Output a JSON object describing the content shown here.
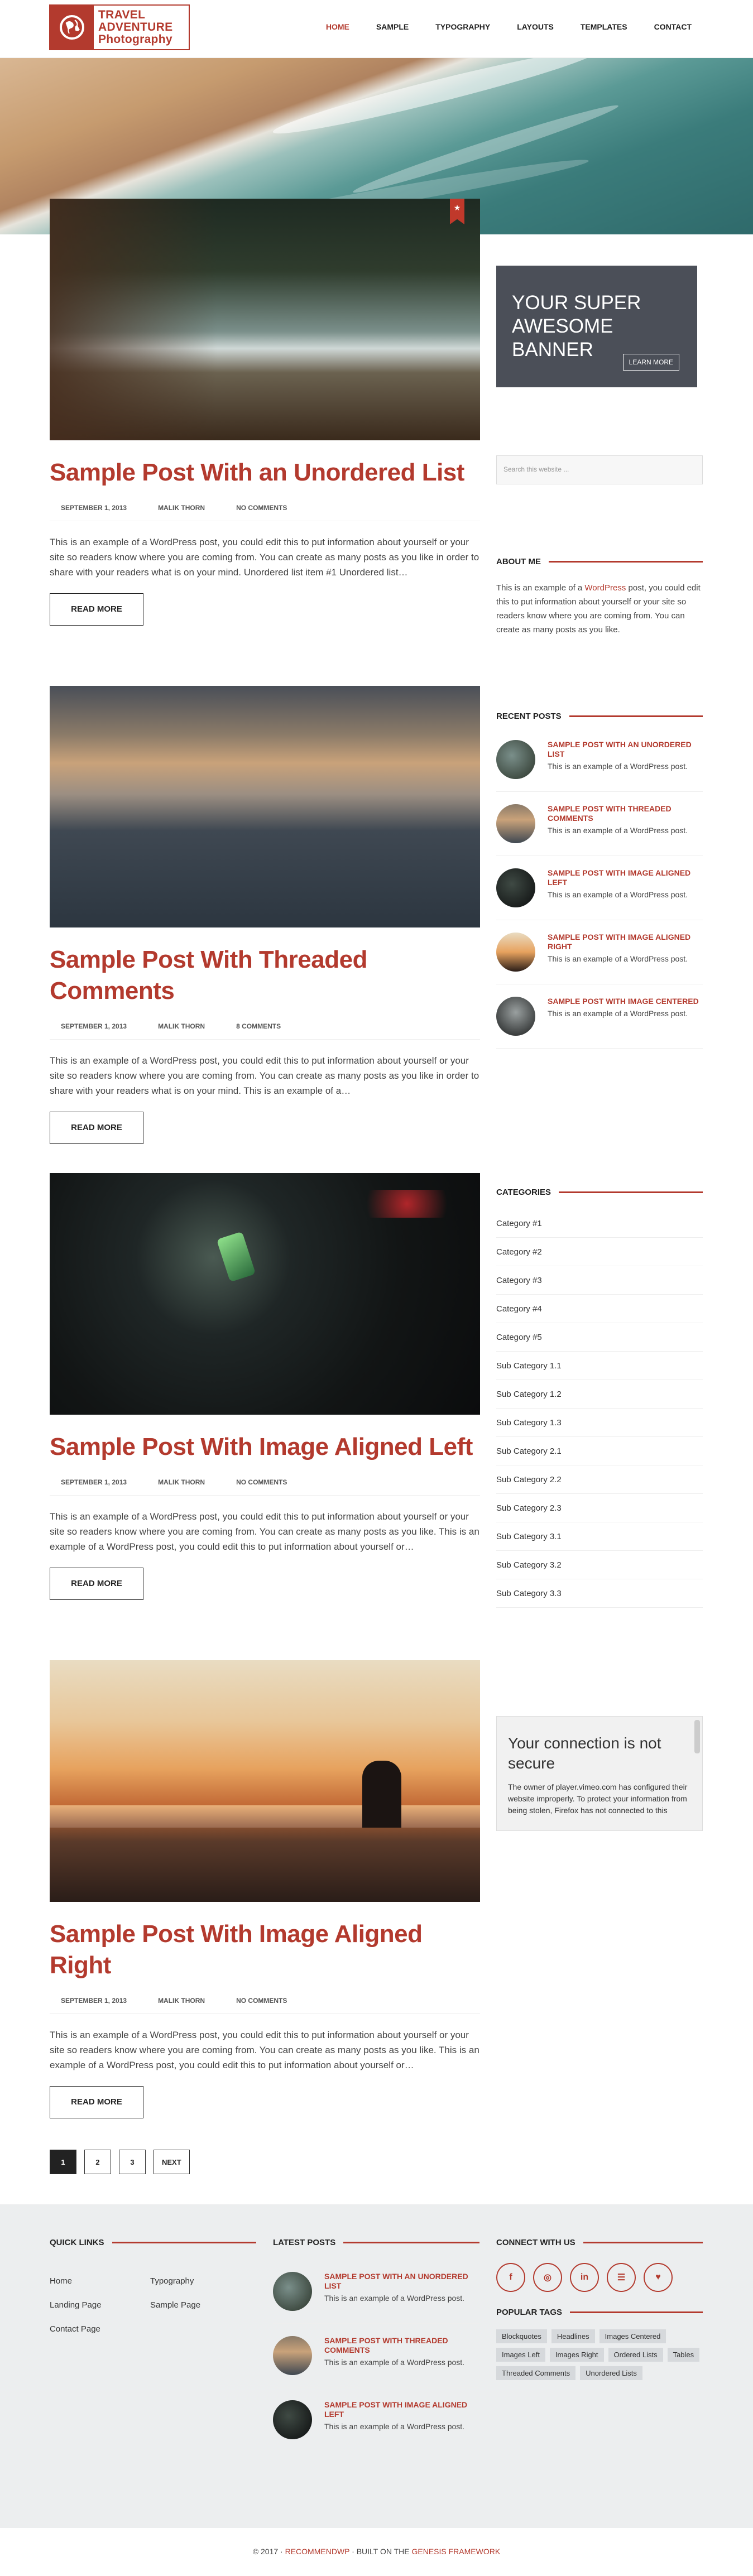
{
  "header": {
    "logo_line1": "TRAVEL",
    "logo_line2": "ADVENTURE",
    "logo_line3": "Photography",
    "nav": [
      "HOME",
      "SAMPLE",
      "TYPOGRAPHY",
      "LAYOUTS",
      "TEMPLATES",
      "CONTACT"
    ],
    "active_nav": "HOME"
  },
  "posts": [
    {
      "title": "Sample Post With an Unordered List",
      "date": "SEPTEMBER 1, 2013",
      "author": "MALIK THORN",
      "comments": "NO COMMENTS",
      "excerpt": "This is an example of a WordPress post, you could edit this to put information about yourself or your site so readers know where you are coming from. You can create as many posts as you like in order to share with your readers what is on your mind. Unordered list item #1 Unordered list…",
      "read_more": "READ MORE",
      "image_tone": "forest-stream"
    },
    {
      "title": "Sample Post With Threaded Comments",
      "date": "SEPTEMBER 1, 2013",
      "author": "MALIK THORN",
      "comments": "8 COMMENTS",
      "excerpt": "This is an example of a WordPress post, you could edit this to put information about yourself or your site so readers know where you are coming from. You can create as many posts as you like in order to share with your readers what is on your mind. This is an example of a…",
      "read_more": "READ MORE",
      "image_tone": "foggy-sea"
    },
    {
      "title": "Sample Post With Image Aligned Left",
      "date": "SEPTEMBER 1, 2013",
      "author": "MALIK THORN",
      "comments": "NO COMMENTS",
      "excerpt": "This is an example of a WordPress post, you could edit this to put information about yourself or your site so readers know where you are coming from. You can create as many posts as you like. This is an example of a WordPress post, you could edit this to put information about yourself or…",
      "read_more": "READ MORE",
      "image_tone": "car-phone"
    },
    {
      "title": "Sample Post With Image Aligned Right",
      "date": "SEPTEMBER 1, 2013",
      "author": "MALIK THORN",
      "comments": "NO COMMENTS",
      "excerpt": "This is an example of a WordPress post, you could edit this to put information about yourself or your site so readers know where you are coming from. You can create as many posts as you like. This is an example of a WordPress post, you could edit this to put information about yourself or…",
      "read_more": "READ MORE",
      "image_tone": "sunset-couple"
    }
  ],
  "sidebar": {
    "banner_text": "YOUR SUPER AWESOME BANNER",
    "banner_button": "LEARN MORE",
    "search_placeholder": "Search this website ...",
    "about_title": "ABOUT ME",
    "about_text_before": "This is an example of a ",
    "about_link": "WordPress",
    "about_text_after": " post, you could edit this to put information about yourself or your site so readers know where you are coming from. You can create as many posts as you like.",
    "recent_title": "RECENT POSTS",
    "recent": [
      {
        "title": "SAMPLE POST WITH AN UNORDERED LIST",
        "text": "This is an example of a WordPress post."
      },
      {
        "title": "SAMPLE POST WITH THREADED COMMENTS",
        "text": "This is an example of a WordPress post."
      },
      {
        "title": "SAMPLE POST WITH IMAGE ALIGNED LEFT",
        "text": "This is an example of a WordPress post."
      },
      {
        "title": "SAMPLE POST WITH IMAGE ALIGNED RIGHT",
        "text": "This is an example of a WordPress post."
      },
      {
        "title": "SAMPLE POST WITH IMAGE CENTERED",
        "text": "This is an example of a WordPress post."
      }
    ],
    "categories_title": "CATEGORIES",
    "categories": [
      "Category #1",
      "Category #2",
      "Category #3",
      "Category #4",
      "Category #5",
      "Sub Category 1.1",
      "Sub Category 1.2",
      "Sub Category 1.3",
      "Sub Category 2.1",
      "Sub Category 2.2",
      "Sub Category 2.3",
      "Sub Category 3.1",
      "Sub Category 3.2",
      "Sub Category 3.3"
    ],
    "video_title": "Your connection is not secure",
    "video_text": "The owner of player.vimeo.com has configured their website improperly. To protect your information from being stolen, Firefox has not connected to this website."
  },
  "pagination": [
    "1",
    "2",
    "3",
    "NEXT"
  ],
  "footer_widgets": {
    "quick_links_title": "QUICK LINKS",
    "quick_links": [
      "Home",
      "Typography",
      "Landing Page",
      "Sample Page",
      "Contact Page"
    ],
    "latest_title": "LATEST POSTS",
    "latest": [
      {
        "title": "SAMPLE POST WITH AN UNORDERED LIST",
        "text": "This is an example of a WordPress post."
      },
      {
        "title": "SAMPLE POST WITH THREADED COMMENTS",
        "text": "This is an example of a WordPress post."
      },
      {
        "title": "SAMPLE POST WITH IMAGE ALIGNED LEFT",
        "text": "This is an example of a WordPress post."
      }
    ],
    "connect_title": "CONNECT WITH US",
    "social_icons": [
      "facebook-icon",
      "instagram-icon",
      "linkedin-icon",
      "rss-icon",
      "twitter-icon"
    ],
    "social_glyphs": [
      "f",
      "◎",
      "in",
      "☰",
      "♥"
    ],
    "tags_title": "POPULAR TAGS",
    "tags": [
      "Blockquotes",
      "Headlines",
      "Images Centered",
      "Images Left",
      "Images Right",
      "Ordered Lists",
      "Tables",
      "Threaded Comments",
      "Unordered Lists"
    ]
  },
  "footer": {
    "prefix": "© 2017 · ",
    "link1": "RECOMMENDWP",
    "middle": " · BUILT ON THE ",
    "link2": "GENESIS FRAMEWORK"
  },
  "colors": {
    "accent": "#b33a2e",
    "banner": "#4b4f58",
    "footer_bg": "#eceeef"
  }
}
